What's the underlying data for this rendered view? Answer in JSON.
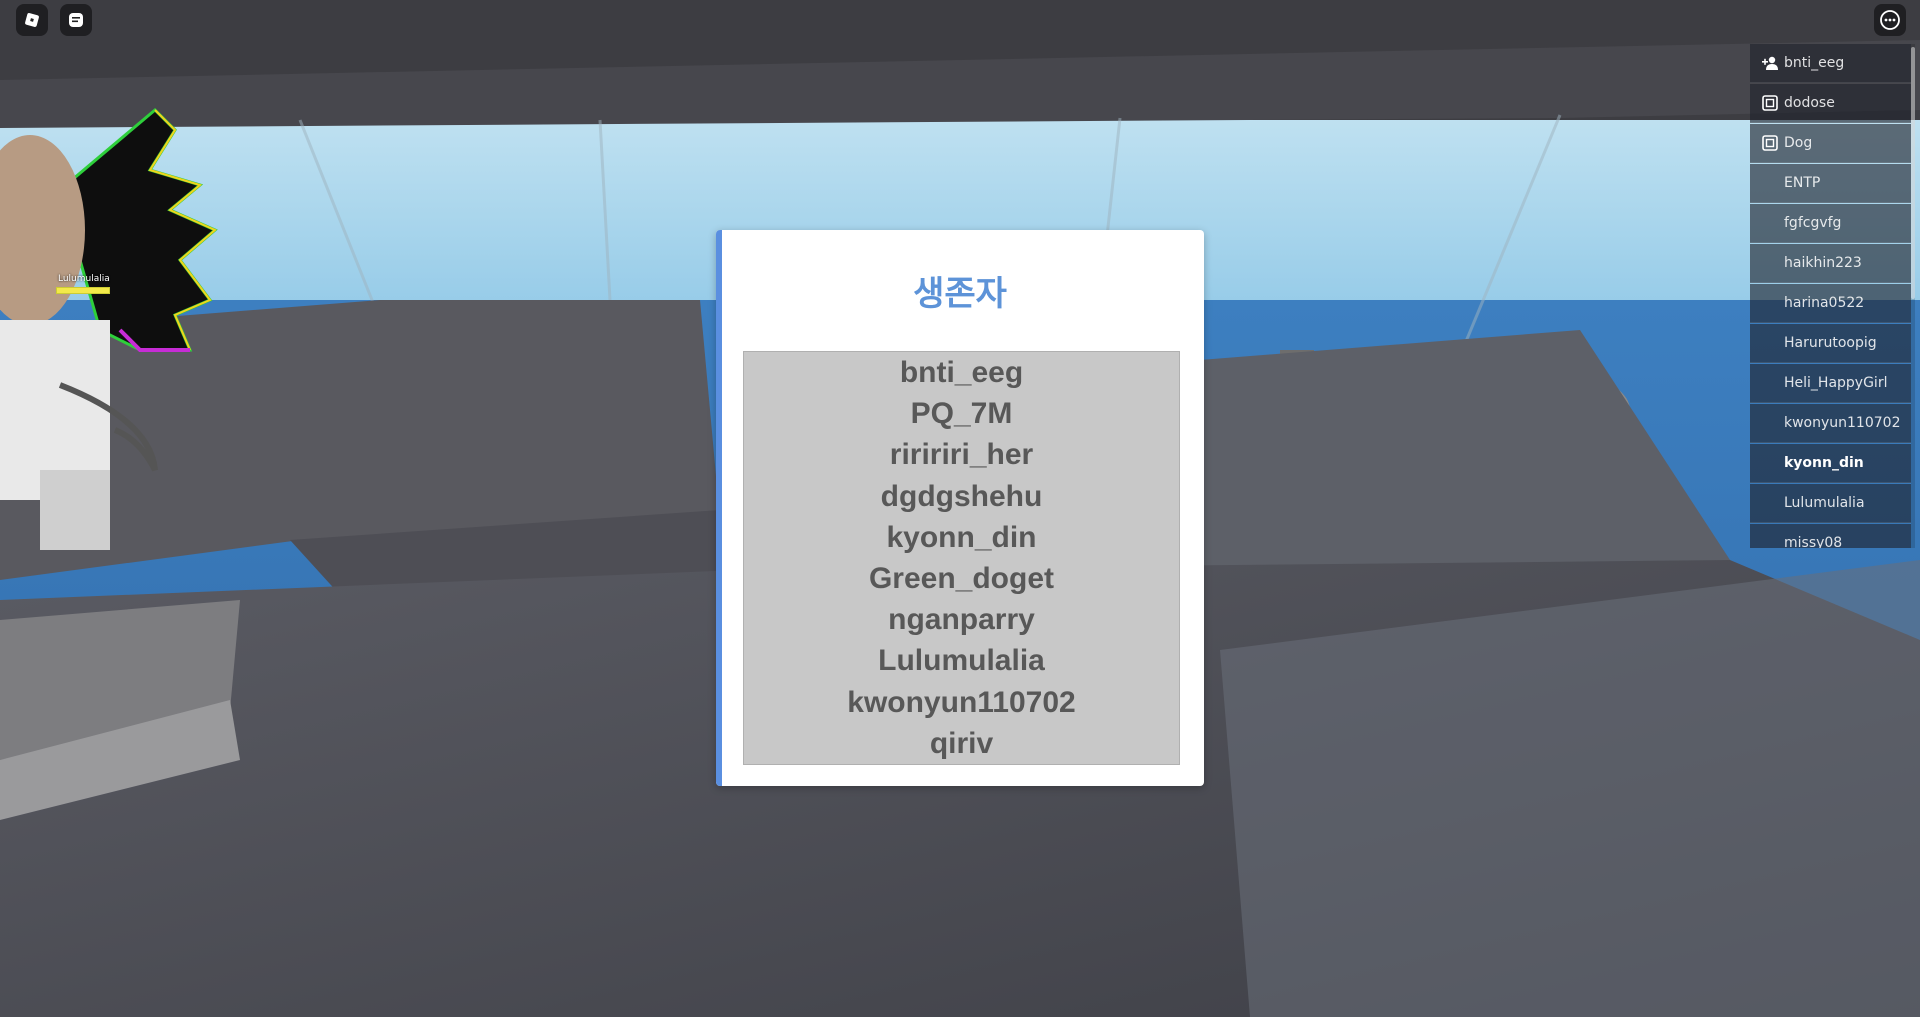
{
  "hud": {
    "menu_icon": "roblox-logo-icon",
    "chat_icon": "chat-icon",
    "more_icon": "more-options-icon"
  },
  "survivors": {
    "title": "생존자",
    "names": [
      "bnti_eeg",
      "PQ_7M",
      "riririri_her",
      "dgdgshehu",
      "kyonn_din",
      "Green_doget",
      "nganparry",
      "Lulumulalia",
      "kwonyun110702",
      "qiriv"
    ]
  },
  "playerlist": {
    "players": [
      {
        "name": "bnti_eeg",
        "icon": "add-friend-icon"
      },
      {
        "name": "dodose",
        "icon": "friend-badge-icon"
      },
      {
        "name": "Dog",
        "icon": "friend-badge-icon"
      },
      {
        "name": "ENTP",
        "icon": ""
      },
      {
        "name": "fgfcgvfg",
        "icon": ""
      },
      {
        "name": "haikhin223",
        "icon": ""
      },
      {
        "name": "harina0522",
        "icon": ""
      },
      {
        "name": "Harurutoopig",
        "icon": ""
      },
      {
        "name": "Heli_HappyGirl",
        "icon": ""
      },
      {
        "name": "kwonyun110702",
        "icon": ""
      },
      {
        "name": "kyonn_din",
        "icon": "",
        "self": true
      },
      {
        "name": "Lulumulalia",
        "icon": ""
      },
      {
        "name": "missy08",
        "icon": ""
      }
    ]
  },
  "avatar": {
    "nametag": "Lulumulalia",
    "health": 1.0
  },
  "colors": {
    "accent": "#5a8fe0",
    "title": "#5d93d8",
    "list_bg": "#c8c8c8",
    "list_text": "#585858"
  }
}
